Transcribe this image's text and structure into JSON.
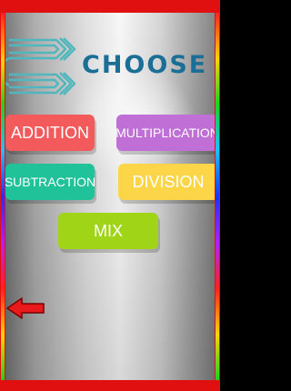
{
  "title": "CHOOSE",
  "buttons": {
    "addition": "ADDITION",
    "multiplication": "MULTIPLICATION",
    "subtraction": "SUBTRACTION",
    "division": "DIVISION",
    "mix": "MIX"
  },
  "colors": {
    "frame": "#e01010",
    "title": "#1b6f96",
    "addition": "#f25a5c",
    "multiplication": "#bf6fd6",
    "subtraction": "#20c29a",
    "division": "#fcd548",
    "mix": "#a0d416",
    "logo_stroke": "#4fb7bd",
    "back_arrow": "#e81a1a"
  },
  "icons": {
    "logo": "chevron-arrows-logo",
    "back": "left-arrow-icon"
  }
}
